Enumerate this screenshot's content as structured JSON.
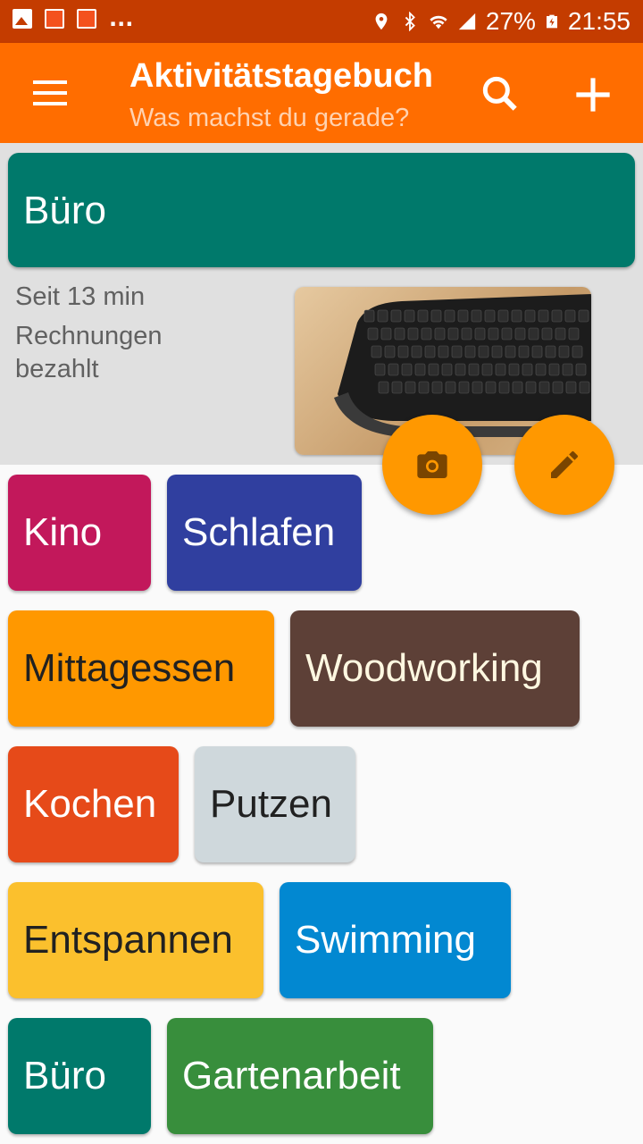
{
  "status_bar": {
    "overflow_indicator": "...",
    "battery": "27%",
    "time": "21:55",
    "icons": [
      "image-notification-icon",
      "app-notification-icon",
      "app-notification-icon",
      "location-icon",
      "bluetooth-icon",
      "wifi-icon",
      "signal-icon",
      "battery-charging-icon"
    ]
  },
  "app_bar": {
    "title": "Aktivitätstagebuch",
    "subtitle": "Was machst du gerade?",
    "icons": [
      "menu-icon",
      "search-icon",
      "add-icon"
    ]
  },
  "current_activity": {
    "name": "Büro",
    "color": "#00796b",
    "since": "Seit 13 min",
    "note": "Rechnungen bezahlt",
    "photo": "keyboard-photo",
    "actions": [
      "camera-icon",
      "edit-icon"
    ]
  },
  "activities": [
    {
      "label": "Kino",
      "color": "#c2185b",
      "text_color": "#ffffff"
    },
    {
      "label": "Schlafen",
      "color": "#303f9f",
      "text_color": "#ffffff"
    },
    {
      "label": "Mittagessen",
      "color": "#ff9800",
      "text_color": "#212121"
    },
    {
      "label": "Woodworking",
      "color": "#5d4037",
      "text_color": "#fff8e1"
    },
    {
      "label": "Kochen",
      "color": "#e64a19",
      "text_color": "#ffffff"
    },
    {
      "label": "Putzen",
      "color": "#cfd8dc",
      "text_color": "#212121"
    },
    {
      "label": "Entspannen",
      "color": "#fbc02d",
      "text_color": "#212121"
    },
    {
      "label": "Swimming",
      "color": "#0288d1",
      "text_color": "#ffffff"
    },
    {
      "label": "Büro",
      "color": "#00796b",
      "text_color": "#ffffff"
    },
    {
      "label": "Gartenarbeit",
      "color": "#388e3c",
      "text_color": "#ffffff"
    }
  ],
  "colors": {
    "status_bar": "#c43c00",
    "app_bar": "#ff6d00",
    "fab": "#ff9800"
  }
}
